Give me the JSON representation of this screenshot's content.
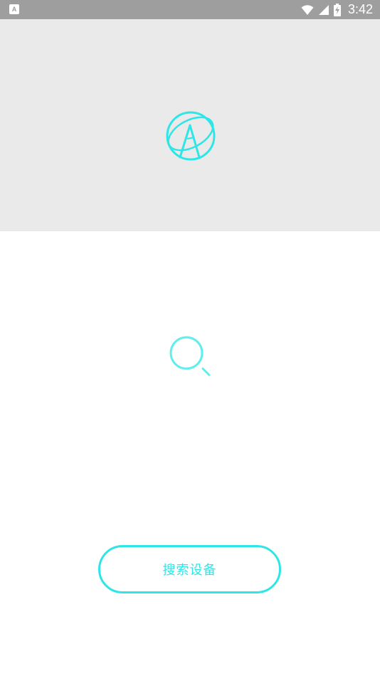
{
  "status_bar": {
    "notification_icon": "A",
    "time": "3:42",
    "icons": [
      "wifi-icon",
      "signal-icon",
      "battery-charging-icon"
    ]
  },
  "brand": {
    "logo": "brand-logo-icon",
    "accent_color": "#2ee6e6"
  },
  "main": {
    "illustration": "search-icon",
    "search_button_label": "搜索设备"
  },
  "colors": {
    "status_bar": "#9e9e9e",
    "header_panel": "#eaeaea",
    "background": "#ffffff",
    "accent": "#2ee6e6"
  }
}
